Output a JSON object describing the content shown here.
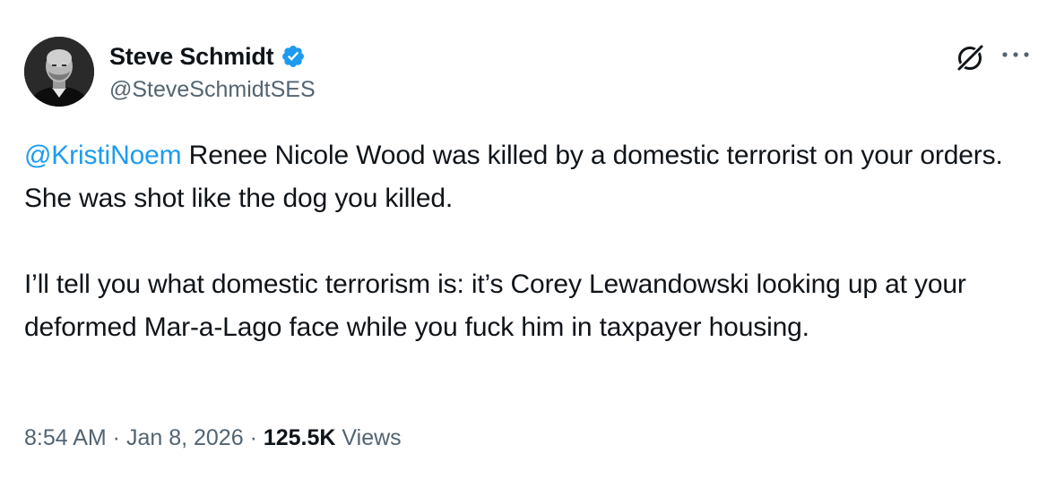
{
  "author": {
    "display_name": "Steve Schmidt",
    "handle": "@SteveSchmidtSES",
    "avatar_icon": "profile-photo",
    "verified_icon": "verified-badge-icon",
    "verified_color": "#1d9bf0"
  },
  "header_actions": {
    "grok_icon": "grok-icon",
    "more_icon": "more-options-icon"
  },
  "tweet": {
    "mention": "@KristiNoem",
    "paragraph1_rest": " Renee Nicole Wood was killed by a domestic terrorist on your orders. She was shot like the dog you killed.",
    "paragraph2": "I’ll tell you what domestic terrorism is: it’s Corey Lewandowski looking up at your deformed Mar-a-Lago face while you fuck him in taxpayer housing."
  },
  "meta": {
    "time": "8:54 AM",
    "separator1": " · ",
    "date": "Jan 8, 2026",
    "separator2": " · ",
    "views_count": "125.5K",
    "views_label": " Views"
  },
  "colors": {
    "text": "#0f1419",
    "secondary": "#536471",
    "link": "#1d9bf0",
    "background": "#ffffff"
  }
}
